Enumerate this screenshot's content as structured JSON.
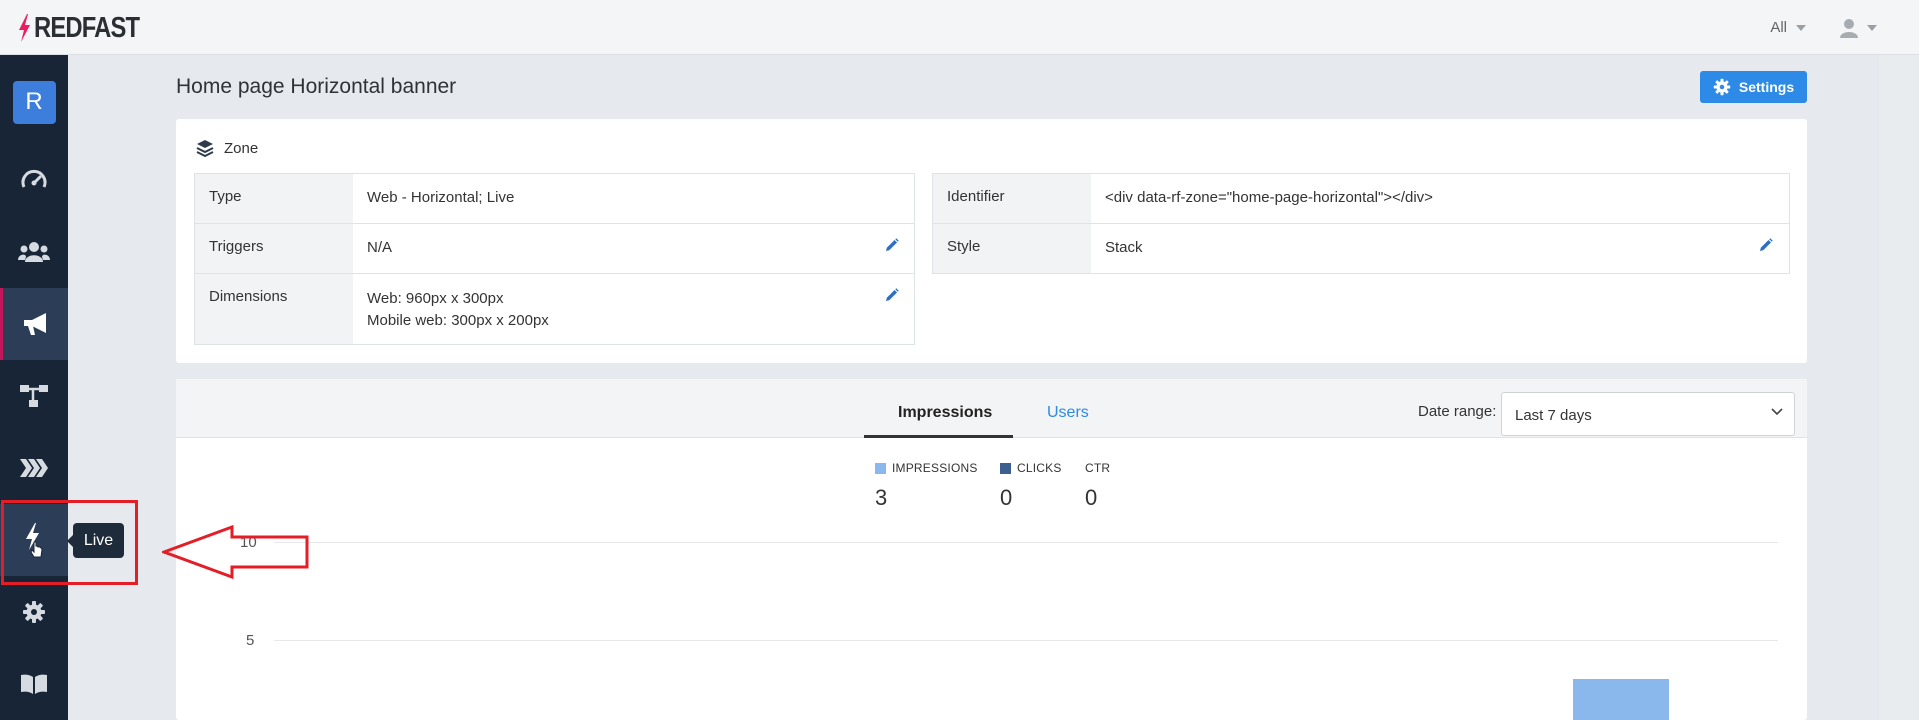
{
  "app": {
    "logo_text": "REDFAST",
    "brand_color": "#e91e63"
  },
  "topbar": {
    "filter_label": "All",
    "user_icon": "user-icon"
  },
  "sidebar": {
    "avatar_letter": "R",
    "items": [
      {
        "name": "dashboard",
        "icon": "speedometer-icon"
      },
      {
        "name": "users",
        "icon": "users-icon"
      },
      {
        "name": "promotions",
        "icon": "megaphone-icon",
        "active": true
      },
      {
        "name": "flows",
        "icon": "sitemap-icon"
      },
      {
        "name": "sequences",
        "icon": "chevrons-icon"
      },
      {
        "name": "live",
        "icon": "bolt-icon",
        "hovered": true
      },
      {
        "name": "settings",
        "icon": "gear-icon"
      },
      {
        "name": "docs",
        "icon": "book-icon"
      }
    ],
    "tooltip": "Live"
  },
  "page": {
    "title": "Home page Horizontal banner",
    "settings_button": "Settings"
  },
  "zone": {
    "heading": "Zone",
    "left_rows": [
      {
        "label": "Type",
        "value": "Web - Horizontal; Live"
      },
      {
        "label": "Triggers",
        "value": "N/A"
      },
      {
        "label": "Dimensions",
        "value_line1": "Web: 960px x 300px",
        "value_line2": "Mobile web: 300px x 200px"
      }
    ],
    "right_rows": [
      {
        "label": "Identifier",
        "value": "<div data-rf-zone=\"home-page-horizontal\"></div>"
      },
      {
        "label": "Style",
        "value": "Stack"
      }
    ]
  },
  "stats": {
    "tabs": [
      "Impressions",
      "Users"
    ],
    "active_tab": "Impressions",
    "date_range_label": "Date range:",
    "date_range_value": "Last 7 days",
    "legend": [
      {
        "label": "IMPRESSIONS",
        "color": "#8ab8ed",
        "value": "3"
      },
      {
        "label": "CLICKS",
        "color": "#3b5f8f",
        "value": "0"
      },
      {
        "label": "CTR",
        "color": "",
        "value": "0"
      }
    ]
  },
  "chart_data": {
    "type": "bar",
    "y_ticks": [
      "10",
      "5"
    ],
    "ylim": [
      0,
      10
    ],
    "series": [
      {
        "name": "IMPRESSIONS",
        "values": [
          3
        ]
      }
    ]
  }
}
